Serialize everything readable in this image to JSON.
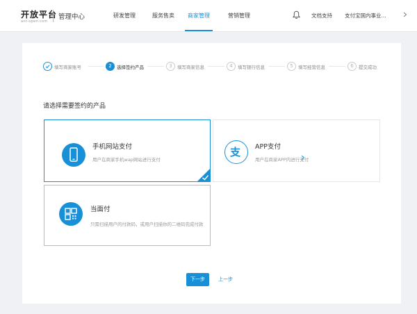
{
  "header": {
    "logo": "开放平台",
    "logo_sub": "ant-open.com",
    "console_title": "管理中心",
    "nav": [
      {
        "label": "研发管理"
      },
      {
        "label": "服务售卖"
      },
      {
        "label": "商家管理"
      },
      {
        "label": "营销管理"
      }
    ],
    "active_nav": "商家管理",
    "docs_label": "文档支持",
    "account_label": "支付宝国内事业..."
  },
  "steps": [
    {
      "number": "1",
      "label": "填写商家账号",
      "status": "done"
    },
    {
      "number": "2",
      "label": "选择签约产品",
      "status": "active"
    },
    {
      "number": "3",
      "label": "填写商家信息",
      "status": "pending"
    },
    {
      "number": "4",
      "label": "填写银行信息",
      "status": "pending"
    },
    {
      "number": "5",
      "label": "填写经营信息",
      "status": "pending"
    },
    {
      "number": "6",
      "label": "提交成功",
      "status": "pending"
    }
  ],
  "section_title": "请选择需要签约的产品",
  "products": [
    {
      "title": "手机网站支付",
      "desc": "用户在商家手机wap网站进行支付",
      "icon": "mobile-phone-icon",
      "selected": true
    },
    {
      "title": "APP支付",
      "desc": "用户在商家APP内进行支付",
      "icon": "alipay-pay-icon",
      "selected": false
    },
    {
      "title": "当面付",
      "desc": "只需扫描用户的付款码，或用户扫描你的二维码完成付款",
      "icon": "qr-code-icon",
      "selected": false
    }
  ],
  "buttons": {
    "next": "下一步",
    "prev": "上一步"
  },
  "colors": {
    "accent": "#1890d7",
    "background": "#eff1f4"
  }
}
